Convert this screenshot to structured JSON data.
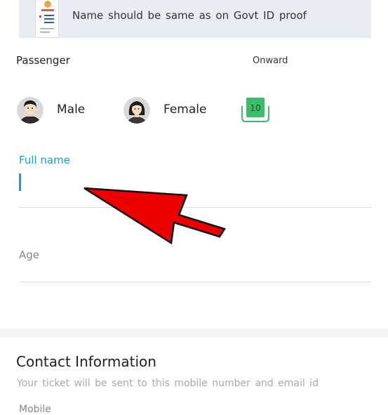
{
  "notice": {
    "text": "Name should be same as on Govt ID proof",
    "icon": "govt-id-document-icon"
  },
  "passenger": {
    "label": "Passenger",
    "journey": "Onward"
  },
  "gender": {
    "male_label": "Male",
    "female_label": "Female"
  },
  "seat": {
    "number": "10",
    "color": "#3cbd6a"
  },
  "form": {
    "full_name_label": "Full name",
    "full_name_value": "",
    "age_placeholder": "Age"
  },
  "contact": {
    "title": "Contact Information",
    "subtitle": "Your ticket will be sent to this mobile number and email id",
    "mobile_label": "Mobile"
  },
  "colors": {
    "accent": "#1a9cd6",
    "arrow": "#ee0000",
    "banner": "#e7edf3"
  }
}
